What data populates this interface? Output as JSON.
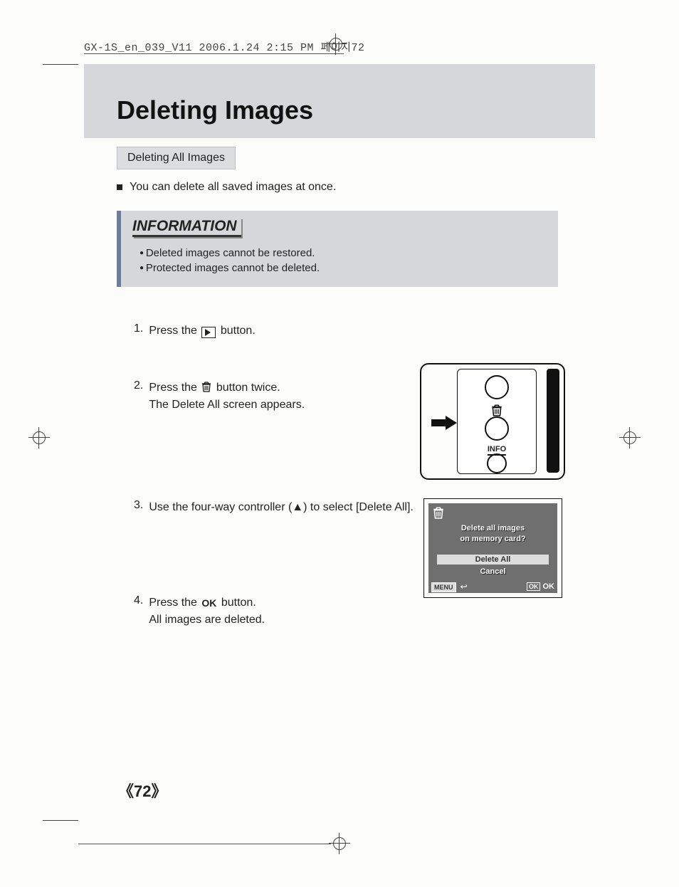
{
  "header": {
    "slug": "GX-1S_en_039_V11  2006.1.24 2:15 PM  페이지72"
  },
  "title": "Deleting Images",
  "subhead": "Deleting All Images",
  "intro": "You can delete all saved images at once.",
  "info": {
    "heading": "INFORMATION",
    "items": [
      "Deleted images cannot be restored.",
      "Protected images cannot be deleted."
    ]
  },
  "steps": {
    "s1a": "Press the",
    "s1b": "button.",
    "s2a": "Press the",
    "s2b": "button twice.",
    "s2c": "The Delete All screen appears.",
    "s3": "Use the four-way controller (▲) to select [Delete All].",
    "s4a": "Press the",
    "s4b": "button.",
    "s4c": "All images are deleted."
  },
  "diagram": {
    "info_label": "INFO"
  },
  "lcd": {
    "line1": "Delete all images",
    "line2": "on memory card?",
    "opt_delete": "Delete All",
    "opt_cancel": "Cancel",
    "menu": "MENU",
    "ok_badge": "OK",
    "ok_text": "OK"
  },
  "icons": {
    "ok": "OK"
  },
  "page_number": "《72》"
}
